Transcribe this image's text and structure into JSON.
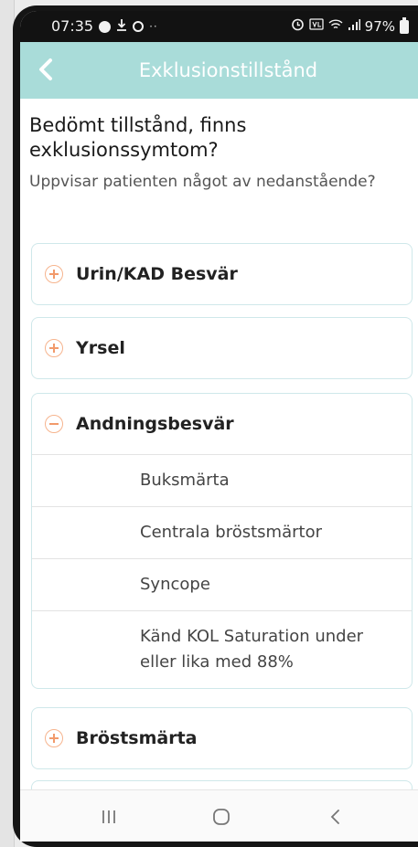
{
  "status_bar": {
    "time": "07:35",
    "battery": "97%",
    "icons": [
      "message-icon",
      "download-icon",
      "location-icon",
      "more-icon",
      "alarm-icon",
      "volte-icon",
      "wifi-icon",
      "signal-icon",
      "battery-icon"
    ]
  },
  "header": {
    "title": "Exklusionstillstånd",
    "back_icon": "chevron-left-icon",
    "color": "#a9dcd9"
  },
  "question": {
    "title": "Bedömt tillstånd, finns exklusionssymtom?",
    "subtitle": "Uppvisar patienten något av nedanstående?"
  },
  "accordion": [
    {
      "label": "Urin/KAD Besvär",
      "expanded": false,
      "icon": "plus-circle-icon"
    },
    {
      "label": "Yrsel",
      "expanded": false,
      "icon": "plus-circle-icon"
    },
    {
      "label": "Andningsbesvär",
      "expanded": true,
      "icon": "minus-circle-icon",
      "items": [
        "Buksmärta",
        "Centrala bröstsmärtor",
        "Syncope",
        "Känd KOL Saturation under eller lika med 88%"
      ]
    },
    {
      "label": "Bröstsmärta",
      "expanded": false,
      "icon": "plus-circle-icon"
    }
  ],
  "nav_bar": {
    "recents_icon": "recents-icon",
    "home_icon": "home-icon",
    "back_icon": "back-icon"
  },
  "accent_color": "#f29a6b"
}
